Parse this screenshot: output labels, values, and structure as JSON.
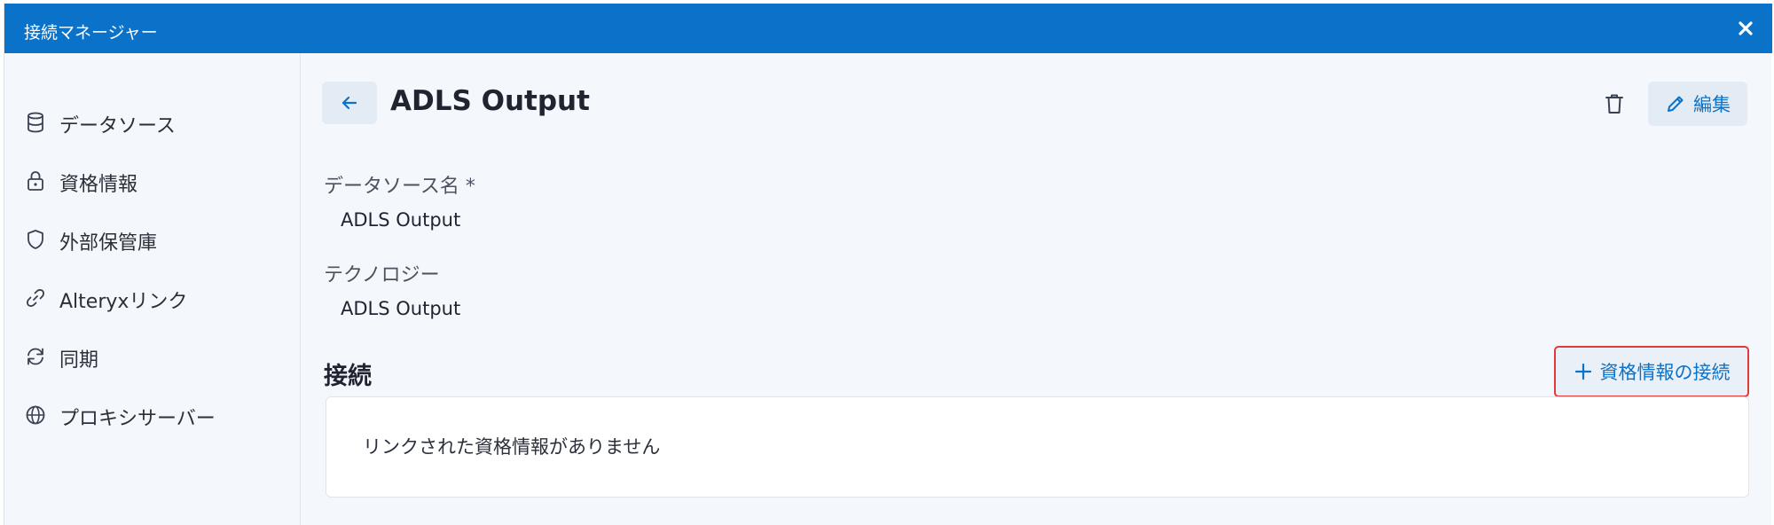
{
  "window": {
    "title": "接続マネージャー",
    "close_icon": "close-icon"
  },
  "sidebar": {
    "items": [
      {
        "label": "データソース",
        "icon": "database-icon"
      },
      {
        "label": "資格情報",
        "icon": "lock-icon"
      },
      {
        "label": "外部保管庫",
        "icon": "shield-icon"
      },
      {
        "label": "Alteryxリンク",
        "icon": "link-icon"
      },
      {
        "label": "同期",
        "icon": "sync-icon"
      },
      {
        "label": "プロキシサーバー",
        "icon": "globe-icon"
      }
    ]
  },
  "header": {
    "back_icon": "arrow-left-icon",
    "title": "ADLS Output",
    "delete_icon": "trash-icon",
    "edit_label": "編集",
    "edit_icon": "pencil-icon"
  },
  "fields": {
    "datasource_name_label": "データソース名 *",
    "datasource_name_value": "ADLS Output",
    "technology_label": "テクノロジー",
    "technology_value": "ADLS Output"
  },
  "connections": {
    "section_title": "接続",
    "connect_button_label": "資格情報の接続",
    "connect_icon": "plus-icon",
    "empty_text": "リンクされた資格情報がありません"
  },
  "colors": {
    "accent": "#0b72c9",
    "highlight_border": "#e23a3a",
    "background": "#f4f7fb"
  }
}
